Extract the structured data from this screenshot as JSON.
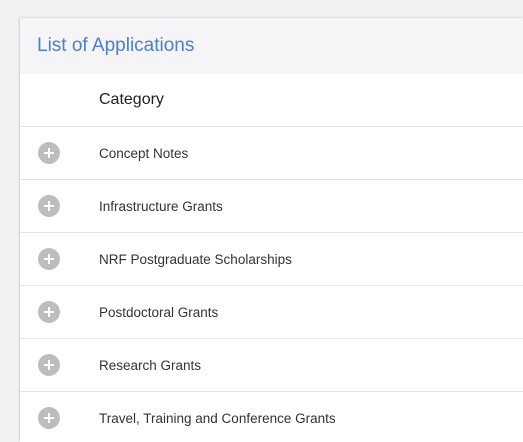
{
  "panel": {
    "title": "List of Applications"
  },
  "table": {
    "column_header": "Category",
    "rows": [
      {
        "label": "Concept Notes"
      },
      {
        "label": "Infrastructure Grants"
      },
      {
        "label": "NRF Postgraduate Scholarships"
      },
      {
        "label": "Postdoctoral Grants"
      },
      {
        "label": "Research Grants"
      },
      {
        "label": "Travel, Training and Conference Grants"
      }
    ]
  },
  "icons": {
    "expand": "plus-circle-icon"
  },
  "colors": {
    "title": "#4f7fc4",
    "header_bg": "#f5f5f7",
    "expand_button": "#bdbdbd"
  }
}
